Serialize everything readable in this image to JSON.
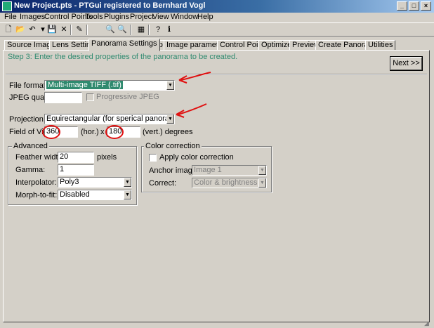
{
  "window": {
    "title": "New Project.pts - PTGui registered to Bernhard Vogl"
  },
  "menu": [
    "File",
    "Images",
    "Control Points",
    "Tools",
    "Plugins",
    "Project",
    "View",
    "Window",
    "Help"
  ],
  "toolbar": [
    "new-icon",
    "open-icon",
    "undo-icon",
    "save-icon",
    "delete-icon",
    "wand-icon",
    "zoom-in-icon",
    "zoom-out-icon",
    "panorama-editor-icon",
    "help-icon",
    "info-icon"
  ],
  "tabs": [
    "Source Images",
    "Lens Settings",
    "Panorama Settings",
    "Crop",
    "Image parameters",
    "Control Points",
    "Optimizer",
    "Preview",
    "Create Panorama",
    "Utilities"
  ],
  "active_tab": "Panorama Settings",
  "step_text": "Step 3: Enter the desired properties of the panorama to be created.",
  "next_label": "Next >>",
  "file_format": {
    "label": "File format:",
    "value": "Multi-image TIFF (.tif)"
  },
  "jpeg": {
    "label": "JPEG quality:",
    "value": "",
    "progressive_label": "Progressive JPEG"
  },
  "projection": {
    "label": "Projection:",
    "value": "Equirectangular (for sperical panorama)"
  },
  "fov": {
    "label": "Field of View:",
    "hor_value": "360",
    "hor_label": "(hor.)",
    "x": "x",
    "vert_value": "180",
    "vert_label": "(vert.) degrees"
  },
  "advanced": {
    "title": "Advanced",
    "feather_label": "Feather width:",
    "feather_value": "20",
    "feather_unit": "pixels",
    "gamma_label": "Gamma:",
    "gamma_value": "1",
    "interpolator_label": "Interpolator:",
    "interpolator_value": "Poly3",
    "morph_label": "Morph-to-fit:",
    "morph_value": "Disabled"
  },
  "color_correction": {
    "title": "Color correction",
    "apply_label": "Apply color correction",
    "anchor_label": "Anchor image:",
    "anchor_value": "Image 1",
    "correct_label": "Correct:",
    "correct_value": "Color & brightness"
  },
  "colors": {
    "title_bar": "#0a246a",
    "step_text": "#2f8a6f",
    "annotation": "#e01010",
    "selected": "#2f8a6f"
  }
}
